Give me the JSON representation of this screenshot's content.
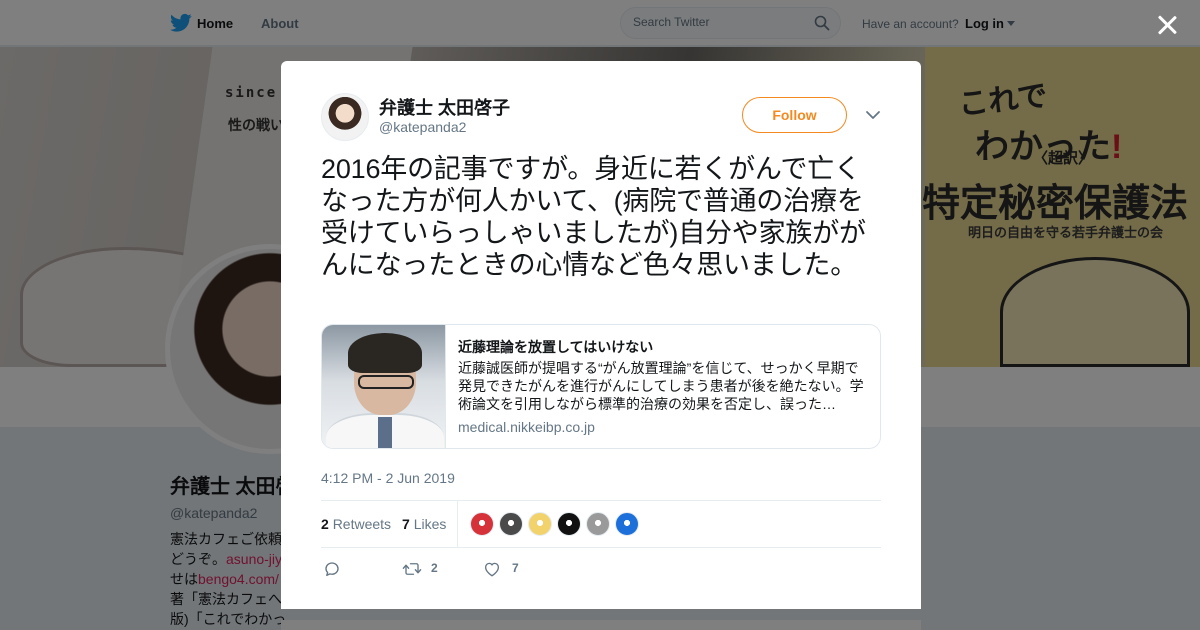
{
  "nav": {
    "home_label": "Home",
    "about_label": "About",
    "search_placeholder": "Search Twitter",
    "have_account_text": "Have an account?",
    "login_label": "Log in",
    "icons": {
      "logo": "twitter-bird-icon",
      "search": "search-icon",
      "caret": "chevron-down-icon"
    }
  },
  "profile_page": {
    "banner_text": {
      "since": "since",
      "line": "性の戦い",
      "book_line1": "これで",
      "book_line2": "わかった",
      "book_line2_mark": "!",
      "book_choyaku": "〈超訳〉",
      "book_line3": "特定秘密保護法",
      "book_subtitle": "明日の自由を守る若手弁護士の会"
    },
    "name": "弁護士 太田啓子",
    "handle": "@katepanda2",
    "bio_lines": [
      "憲法カフェご依頼",
      "どうぞ。",
      "せは",
      "著「憲法カフェへ",
      "版)「これでわかっ"
    ],
    "bio_links": [
      "asuno-jiy",
      "bengo4.com/"
    ]
  },
  "modal": {
    "close_icon": "close-icon",
    "author": {
      "name": "弁護士 太田啓子",
      "handle": "@katepanda2"
    },
    "follow_label": "Follow",
    "tweet_text": "2016年の記事ですが。身近に若くがんで亡くなった方が何人かいて、(病院で普通の治療を受けていらっしゃいましたが)自分や家族ががんになったときの心情など色々思いました。",
    "card": {
      "title": "近藤理論を放置してはいけない",
      "description": "近藤誠医師が提唱する“がん放置理論”を信じて、せっかく早期で発見できたがんを進行がんにしてしまう患者が後を絶たない。学術論文を引用しながら標準的治療の効果を否定し、誤った…",
      "domain": "medical.nikkeibp.co.jp"
    },
    "timestamp": "4:12 PM - 2 Jun 2019",
    "stats": {
      "retweets_count": "2",
      "retweets_label": "Retweets",
      "likes_count": "7",
      "likes_label": "Likes"
    },
    "liker_colors": [
      "#d6323a",
      "#4a4a4a",
      "#f2d36b",
      "#111111",
      "#9a9a9a",
      "#1d6fd9"
    ],
    "actions": {
      "reply_icon": "reply-icon",
      "retweet_icon": "retweet-icon",
      "retweet_count": "2",
      "like_icon": "heart-icon",
      "like_count": "7"
    }
  },
  "colors": {
    "accent": "#f4891f",
    "text": "#14171a",
    "secondary_text": "#657786",
    "twitter_blue": "#1da1f2",
    "link": "#e0245e"
  }
}
